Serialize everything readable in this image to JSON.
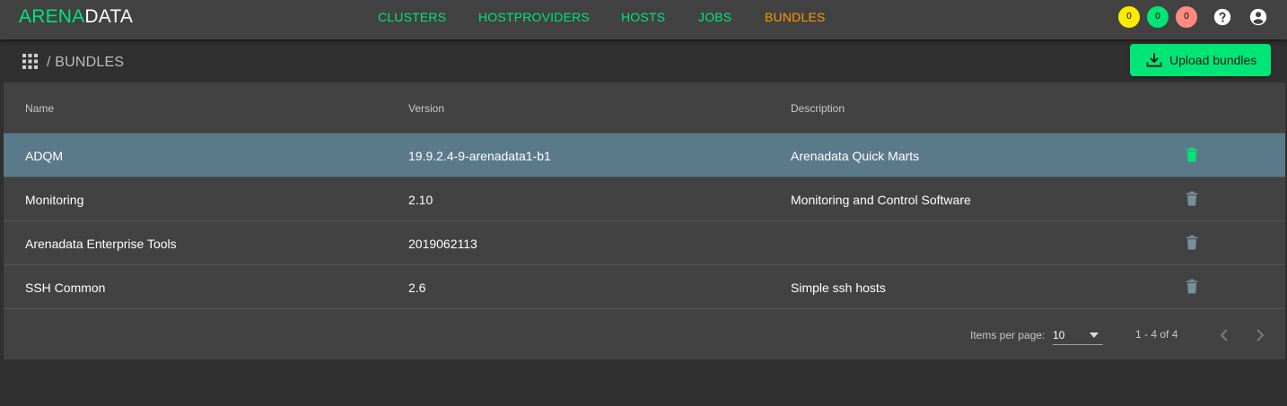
{
  "header": {
    "logo_part1": "ARENA",
    "logo_part2": "DATA",
    "nav": [
      {
        "label": "CLUSTERS"
      },
      {
        "label": "HOSTPROVIDERS"
      },
      {
        "label": "HOSTS"
      },
      {
        "label": "JOBS"
      },
      {
        "label": "BUNDLES",
        "active": true
      }
    ],
    "badges": [
      "0",
      "0",
      "0"
    ],
    "icons": [
      "help-icon",
      "account-circle-icon"
    ]
  },
  "subheader": {
    "apps_icon": "apps-grid-icon",
    "breadcrumb": "/ BUNDLES",
    "upload_button": "Upload bundles"
  },
  "table": {
    "columns": [
      "Name",
      "Version",
      "Description"
    ],
    "rows": [
      {
        "name": "ADQM",
        "version": "19.9.2.4-9-arenadata1-b1",
        "description": "Arenadata Quick Marts",
        "selected": true
      },
      {
        "name": "Monitoring",
        "version": "2.10",
        "description": "Monitoring and Control Software"
      },
      {
        "name": "Arenadata Enterprise Tools",
        "version": "2019062113",
        "description": ""
      },
      {
        "name": "SSH Common",
        "version": "2.6",
        "description": "Simple ssh hosts"
      }
    ]
  },
  "paginator": {
    "items_per_page_label": "Items per page:",
    "items_per_page": "10",
    "range": "1 - 4 of 4"
  },
  "colors": {
    "accent": "#00e676",
    "active_nav": "#ff9800",
    "selected_row": "#5a7a8a",
    "delete_icon": "#78909c"
  }
}
